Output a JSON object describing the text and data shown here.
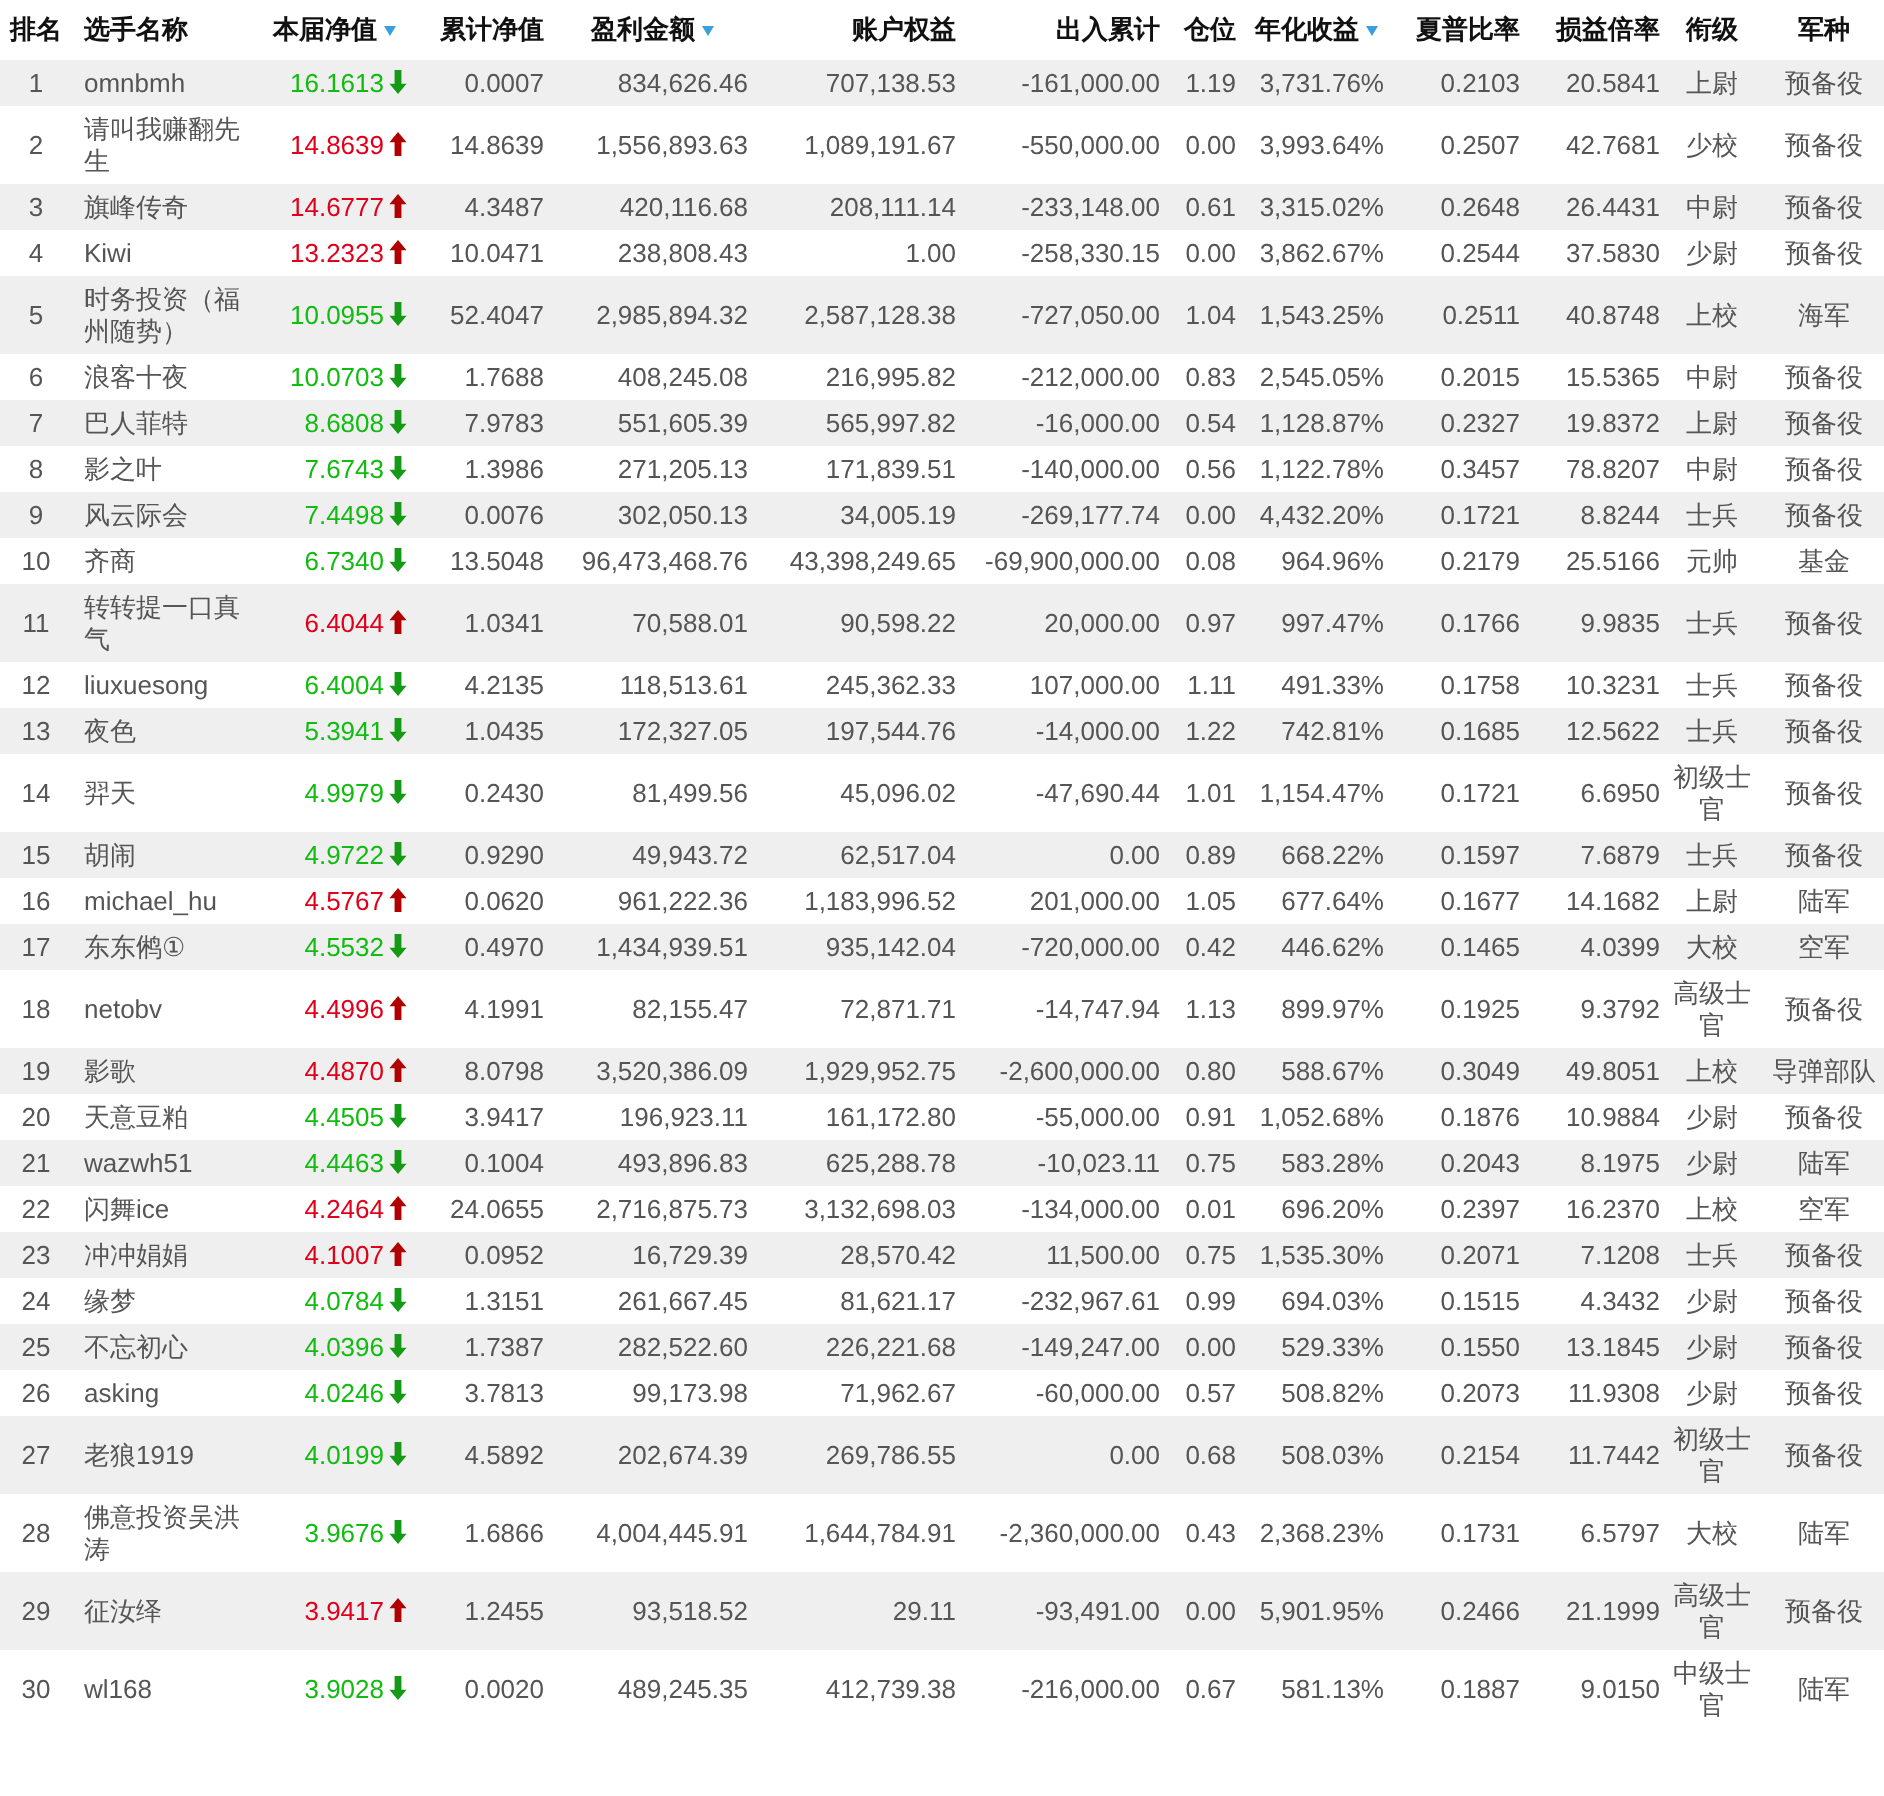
{
  "table": {
    "columns": [
      {
        "label": "排名",
        "sort_indicator": false
      },
      {
        "label": "选手名称",
        "sort_indicator": false
      },
      {
        "label": "本届净值",
        "sort_indicator": true
      },
      {
        "label": "累计净值",
        "sort_indicator": false
      },
      {
        "label": "盈利金额",
        "sort_indicator": true
      },
      {
        "label": "账户权益",
        "sort_indicator": false
      },
      {
        "label": "出入累计",
        "sort_indicator": false
      },
      {
        "label": "仓位",
        "sort_indicator": false
      },
      {
        "label": "年化收益",
        "sort_indicator": true
      },
      {
        "label": "夏普比率",
        "sort_indicator": false
      },
      {
        "label": "损益倍率",
        "sort_indicator": false
      },
      {
        "label": "衔级",
        "sort_indicator": false
      },
      {
        "label": "军种",
        "sort_indicator": false
      }
    ],
    "rows": [
      {
        "rising": false,
        "cells": [
          "1",
          "omnbmh",
          "16.1613",
          "0.0007",
          "834,626.46",
          "707,138.53",
          "-161,000.00",
          "1.19",
          "3,731.76%",
          "0.2103",
          "20.5841",
          "上尉",
          "预备役"
        ]
      },
      {
        "rising": true,
        "cells": [
          "2",
          "请叫我赚翻先生",
          "14.8639",
          "14.8639",
          "1,556,893.63",
          "1,089,191.67",
          "-550,000.00",
          "0.00",
          "3,993.64%",
          "0.2507",
          "42.7681",
          "少校",
          "预备役"
        ]
      },
      {
        "rising": true,
        "cells": [
          "3",
          "旗峰传奇",
          "14.6777",
          "4.3487",
          "420,116.68",
          "208,111.14",
          "-233,148.00",
          "0.61",
          "3,315.02%",
          "0.2648",
          "26.4431",
          "中尉",
          "预备役"
        ]
      },
      {
        "rising": true,
        "cells": [
          "4",
          "Kiwi",
          "13.2323",
          "10.0471",
          "238,808.43",
          "1.00",
          "-258,330.15",
          "0.00",
          "3,862.67%",
          "0.2544",
          "37.5830",
          "少尉",
          "预备役"
        ]
      },
      {
        "rising": false,
        "cells": [
          "5",
          "时务投资（福州随势）",
          "10.0955",
          "52.4047",
          "2,985,894.32",
          "2,587,128.38",
          "-727,050.00",
          "1.04",
          "1,543.25%",
          "0.2511",
          "40.8748",
          "上校",
          "海军"
        ]
      },
      {
        "rising": false,
        "cells": [
          "6",
          "浪客十夜",
          "10.0703",
          "1.7688",
          "408,245.08",
          "216,995.82",
          "-212,000.00",
          "0.83",
          "2,545.05%",
          "0.2015",
          "15.5365",
          "中尉",
          "预备役"
        ]
      },
      {
        "rising": false,
        "cells": [
          "7",
          "巴人菲特",
          "8.6808",
          "7.9783",
          "551,605.39",
          "565,997.82",
          "-16,000.00",
          "0.54",
          "1,128.87%",
          "0.2327",
          "19.8372",
          "上尉",
          "预备役"
        ]
      },
      {
        "rising": false,
        "cells": [
          "8",
          "影之叶",
          "7.6743",
          "1.3986",
          "271,205.13",
          "171,839.51",
          "-140,000.00",
          "0.56",
          "1,122.78%",
          "0.3457",
          "78.8207",
          "中尉",
          "预备役"
        ]
      },
      {
        "rising": false,
        "cells": [
          "9",
          "风云际会",
          "7.4498",
          "0.0076",
          "302,050.13",
          "34,005.19",
          "-269,177.74",
          "0.00",
          "4,432.20%",
          "0.1721",
          "8.8244",
          "士兵",
          "预备役"
        ]
      },
      {
        "rising": false,
        "cells": [
          "10",
          "齐商",
          "6.7340",
          "13.5048",
          "96,473,468.76",
          "43,398,249.65",
          "-69,900,000.00",
          "0.08",
          "964.96%",
          "0.2179",
          "25.5166",
          "元帅",
          "基金"
        ]
      },
      {
        "rising": true,
        "cells": [
          "11",
          "转转提一口真气",
          "6.4044",
          "1.0341",
          "70,588.01",
          "90,598.22",
          "20,000.00",
          "0.97",
          "997.47%",
          "0.1766",
          "9.9835",
          "士兵",
          "预备役"
        ]
      },
      {
        "rising": false,
        "cells": [
          "12",
          "liuxuesong",
          "6.4004",
          "4.2135",
          "118,513.61",
          "245,362.33",
          "107,000.00",
          "1.11",
          "491.33%",
          "0.1758",
          "10.3231",
          "士兵",
          "预备役"
        ]
      },
      {
        "rising": false,
        "cells": [
          "13",
          "夜色",
          "5.3941",
          "1.0435",
          "172,327.05",
          "197,544.76",
          "-14,000.00",
          "1.22",
          "742.81%",
          "0.1685",
          "12.5622",
          "士兵",
          "预备役"
        ]
      },
      {
        "rising": false,
        "cells": [
          "14",
          "羿天",
          "4.9979",
          "0.2430",
          "81,499.56",
          "45,096.02",
          "-47,690.44",
          "1.01",
          "1,154.47%",
          "0.1721",
          "6.6950",
          "初级士官",
          "预备役"
        ]
      },
      {
        "rising": false,
        "cells": [
          "15",
          "胡闹",
          "4.9722",
          "0.9290",
          "49,943.72",
          "62,517.04",
          "0.00",
          "0.89",
          "668.22%",
          "0.1597",
          "7.6879",
          "士兵",
          "预备役"
        ]
      },
      {
        "rising": true,
        "cells": [
          "16",
          "michael_hu",
          "4.5767",
          "0.0620",
          "961,222.36",
          "1,183,996.52",
          "201,000.00",
          "1.05",
          "677.64%",
          "0.1677",
          "14.1682",
          "上尉",
          "陆军"
        ]
      },
      {
        "rising": false,
        "cells": [
          "17",
          "东东鸺①",
          "4.5532",
          "0.4970",
          "1,434,939.51",
          "935,142.04",
          "-720,000.00",
          "0.42",
          "446.62%",
          "0.1465",
          "4.0399",
          "大校",
          "空军"
        ]
      },
      {
        "rising": true,
        "cells": [
          "18",
          "netobv",
          "4.4996",
          "4.1991",
          "82,155.47",
          "72,871.71",
          "-14,747.94",
          "1.13",
          "899.97%",
          "0.1925",
          "9.3792",
          "高级士官",
          "预备役"
        ]
      },
      {
        "rising": true,
        "cells": [
          "19",
          "影歌",
          "4.4870",
          "8.0798",
          "3,520,386.09",
          "1,929,952.75",
          "-2,600,000.00",
          "0.80",
          "588.67%",
          "0.3049",
          "49.8051",
          "上校",
          "导弹部队"
        ]
      },
      {
        "rising": false,
        "cells": [
          "20",
          "天意豆粕",
          "4.4505",
          "3.9417",
          "196,923.11",
          "161,172.80",
          "-55,000.00",
          "0.91",
          "1,052.68%",
          "0.1876",
          "10.9884",
          "少尉",
          "预备役"
        ]
      },
      {
        "rising": false,
        "cells": [
          "21",
          "wazwh51",
          "4.4463",
          "0.1004",
          "493,896.83",
          "625,288.78",
          "-10,023.11",
          "0.75",
          "583.28%",
          "0.2043",
          "8.1975",
          "少尉",
          "陆军"
        ]
      },
      {
        "rising": true,
        "cells": [
          "22",
          "闪舞ice",
          "4.2464",
          "24.0655",
          "2,716,875.73",
          "3,132,698.03",
          "-134,000.00",
          "0.01",
          "696.20%",
          "0.2397",
          "16.2370",
          "上校",
          "空军"
        ]
      },
      {
        "rising": true,
        "cells": [
          "23",
          "冲冲娟娟",
          "4.1007",
          "0.0952",
          "16,729.39",
          "28,570.42",
          "11,500.00",
          "0.75",
          "1,535.30%",
          "0.2071",
          "7.1208",
          "士兵",
          "预备役"
        ]
      },
      {
        "rising": false,
        "cells": [
          "24",
          "缘梦",
          "4.0784",
          "1.3151",
          "261,667.45",
          "81,621.17",
          "-232,967.61",
          "0.99",
          "694.03%",
          "0.1515",
          "4.3432",
          "少尉",
          "预备役"
        ]
      },
      {
        "rising": false,
        "cells": [
          "25",
          "不忘初心",
          "4.0396",
          "1.7387",
          "282,522.60",
          "226,221.68",
          "-149,247.00",
          "0.00",
          "529.33%",
          "0.1550",
          "13.1845",
          "少尉",
          "预备役"
        ]
      },
      {
        "rising": false,
        "cells": [
          "26",
          "asking",
          "4.0246",
          "3.7813",
          "99,173.98",
          "71,962.67",
          "-60,000.00",
          "0.57",
          "508.82%",
          "0.2073",
          "11.9308",
          "少尉",
          "预备役"
        ]
      },
      {
        "rising": false,
        "cells": [
          "27",
          "老狼1919",
          "4.0199",
          "4.5892",
          "202,674.39",
          "269,786.55",
          "0.00",
          "0.68",
          "508.03%",
          "0.2154",
          "11.7442",
          "初级士官",
          "预备役"
        ]
      },
      {
        "rising": false,
        "cells": [
          "28",
          "佛意投资吴洪涛",
          "3.9676",
          "1.6866",
          "4,004,445.91",
          "1,644,784.91",
          "-2,360,000.00",
          "0.43",
          "2,368.23%",
          "0.1731",
          "6.5797",
          "大校",
          "陆军"
        ]
      },
      {
        "rising": true,
        "cells": [
          "29",
          "征汝绎",
          "3.9417",
          "1.2455",
          "93,518.52",
          "29.11",
          "-93,491.00",
          "0.00",
          "5,901.95%",
          "0.2466",
          "21.1999",
          "高级士官",
          "预备役"
        ]
      },
      {
        "rising": false,
        "cells": [
          "30",
          "wl168",
          "3.9028",
          "0.0020",
          "489,245.35",
          "412,739.38",
          "-216,000.00",
          "0.67",
          "581.13%",
          "0.1887",
          "9.0150",
          "中级士官",
          "陆军"
        ]
      }
    ]
  }
}
